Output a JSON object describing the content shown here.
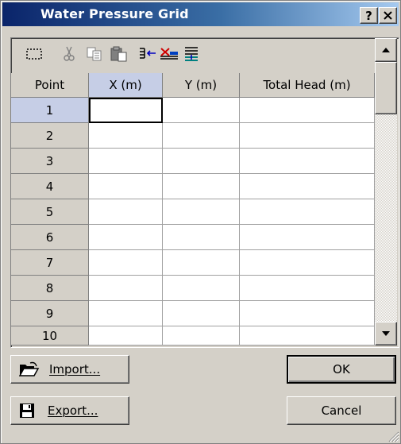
{
  "window": {
    "title": "Water Pressure Grid"
  },
  "titlebar_buttons": {
    "help": "?",
    "close": "✕"
  },
  "toolbar": {
    "icons": [
      "select-all-icon",
      "cut-icon",
      "copy-icon",
      "paste-icon",
      "insert-row-icon",
      "delete-row-icon",
      "append-row-icon"
    ]
  },
  "grid": {
    "columns": [
      "Point",
      "X (m)",
      "Y (m)",
      "Total Head (m)"
    ],
    "rows": [
      {
        "point": "1",
        "x": "",
        "y": "",
        "head": ""
      },
      {
        "point": "2",
        "x": "",
        "y": "",
        "head": ""
      },
      {
        "point": "3",
        "x": "",
        "y": "",
        "head": ""
      },
      {
        "point": "4",
        "x": "",
        "y": "",
        "head": ""
      },
      {
        "point": "5",
        "x": "",
        "y": "",
        "head": ""
      },
      {
        "point": "6",
        "x": "",
        "y": "",
        "head": ""
      },
      {
        "point": "7",
        "x": "",
        "y": "",
        "head": ""
      },
      {
        "point": "8",
        "x": "",
        "y": "",
        "head": ""
      },
      {
        "point": "9",
        "x": "",
        "y": "",
        "head": ""
      },
      {
        "point": "10",
        "x": "",
        "y": "",
        "head": ""
      }
    ],
    "selected_row": "1",
    "active_cell": "X (m)"
  },
  "buttons": {
    "import": "Import...",
    "export": "Export...",
    "ok": "OK",
    "cancel": "Cancel"
  },
  "colors": {
    "title_start": "#0a246a",
    "title_end": "#a6caf0",
    "face": "#d4d0c8",
    "header_highlight": "#c6cee6"
  }
}
